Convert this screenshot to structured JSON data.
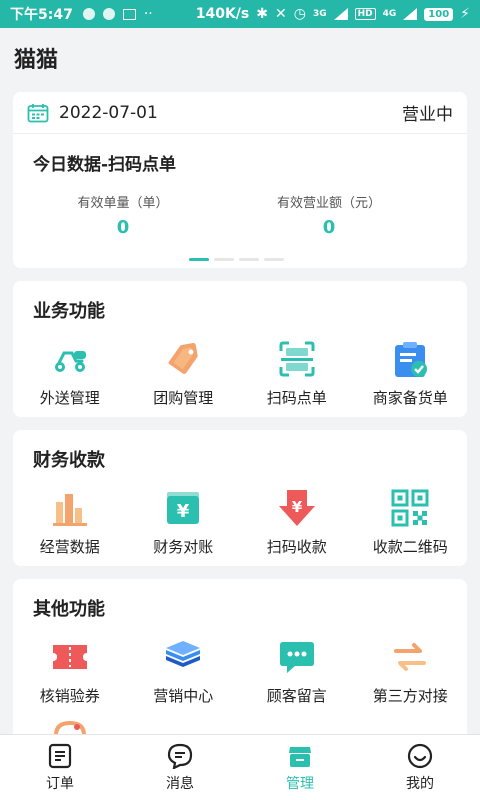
{
  "status_bar": {
    "time": "下午5:47",
    "network_speed": "140K/s",
    "net_3g": "3G",
    "hd": "HD",
    "net_4g": "4G",
    "battery": "100"
  },
  "page_title": "猫猫",
  "today": {
    "date": "2022-07-01",
    "status": "营业中",
    "title": "今日数据-扫码点单",
    "stats": [
      {
        "label": "有效单量（单）",
        "value": "0"
      },
      {
        "label": "有效营业额（元）",
        "value": "0"
      }
    ],
    "carousel_pages": 4,
    "carousel_active": 1
  },
  "sections": {
    "business": {
      "title": "业务功能",
      "items": [
        {
          "label": "外送管理",
          "icon": "scooter-icon"
        },
        {
          "label": "团购管理",
          "icon": "tag-icon"
        },
        {
          "label": "扫码点单",
          "icon": "scan-icon"
        },
        {
          "label": "商家备货单",
          "icon": "clipboard-check-icon"
        }
      ]
    },
    "finance": {
      "title": "财务收款",
      "items": [
        {
          "label": "经营数据",
          "icon": "bar-chart-icon"
        },
        {
          "label": "财务对账",
          "icon": "yuan-wallet-icon"
        },
        {
          "label": "扫码收款",
          "icon": "yuan-down-arrow-icon"
        },
        {
          "label": "收款二维码",
          "icon": "qr-code-icon"
        }
      ]
    },
    "other": {
      "title": "其他功能",
      "items": [
        {
          "label": "核销验券",
          "icon": "ticket-icon"
        },
        {
          "label": "营销中心",
          "icon": "layers-icon"
        },
        {
          "label": "顾客留言",
          "icon": "chat-bubble-icon"
        },
        {
          "label": "第三方对接",
          "icon": "swap-arrows-icon"
        }
      ],
      "partial_item_icon": "headset-icon"
    }
  },
  "tabbar": {
    "items": [
      {
        "label": "订单",
        "icon": "order-list-icon"
      },
      {
        "label": "消息",
        "icon": "message-icon"
      },
      {
        "label": "管理",
        "icon": "store-icon"
      },
      {
        "label": "我的",
        "icon": "smile-icon"
      }
    ],
    "active": "管理"
  },
  "colors": {
    "status_bar": "#25b8a8",
    "accent": "#2bbfb0",
    "background": "#f2f3f5",
    "card": "#ffffff"
  }
}
